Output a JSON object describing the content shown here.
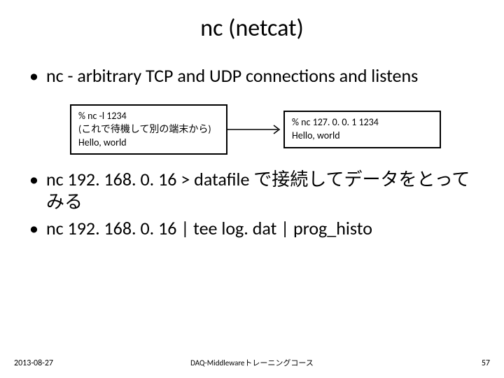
{
  "title": "nc (netcat)",
  "bullets": {
    "first": "nc - arbitrary TCP and UDP connections and listens",
    "second": "nc 192. 168. 0. 16 > datafile で接続してデータをとってみる",
    "third": "nc 192. 168. 0. 16 | tee log. dat | prog_histo"
  },
  "leftBox": {
    "l1": "% nc   -l   1234",
    "l2": "(これで待機して別の端末から)",
    "l3": "Hello, world"
  },
  "rightBox": {
    "l1": "% nc   127. 0. 0. 1   1234",
    "l2": "Hello, world"
  },
  "footer": {
    "date": "2013-08-27",
    "center": "DAQ-Middlewareトレーニングコース",
    "page": "57"
  }
}
